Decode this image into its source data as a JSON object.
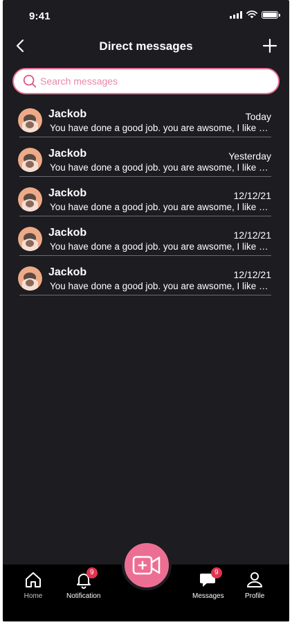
{
  "status_bar": {
    "time": "9:41"
  },
  "header": {
    "title": "Direct messages"
  },
  "search": {
    "placeholder": "Search messages"
  },
  "conversations": [
    {
      "name": "Jackob",
      "time": "Today",
      "preview": "You have done a good job. you are awsome, I like your work"
    },
    {
      "name": "Jackob",
      "time": "Yesterday",
      "preview": "You have done a good job. you are awsome, I like your work"
    },
    {
      "name": "Jackob",
      "time": "12/12/21",
      "preview": "You have done a good job. you are awsome, I like your work"
    },
    {
      "name": "Jackob",
      "time": "12/12/21",
      "preview": "You have done a good job. you are awsome, I like your work"
    },
    {
      "name": "Jackob",
      "time": "12/12/21",
      "preview": "You have done a good job. you are awsome, I like your work"
    }
  ],
  "bottom_nav": {
    "home": {
      "label": "Home",
      "icon": "home-icon"
    },
    "notification": {
      "label": "Notification",
      "icon": "bell-icon",
      "badge": "9"
    },
    "create": {
      "icon": "video-plus-icon"
    },
    "messages": {
      "label": "Messages",
      "icon": "chat-bubble-icon",
      "badge": "9"
    },
    "profile": {
      "label": "Profile",
      "icon": "user-icon"
    }
  },
  "colors": {
    "background": "#1c1c21",
    "accent": "#ec6f93",
    "badge": "#e0344f",
    "nav_background": "#000000"
  }
}
